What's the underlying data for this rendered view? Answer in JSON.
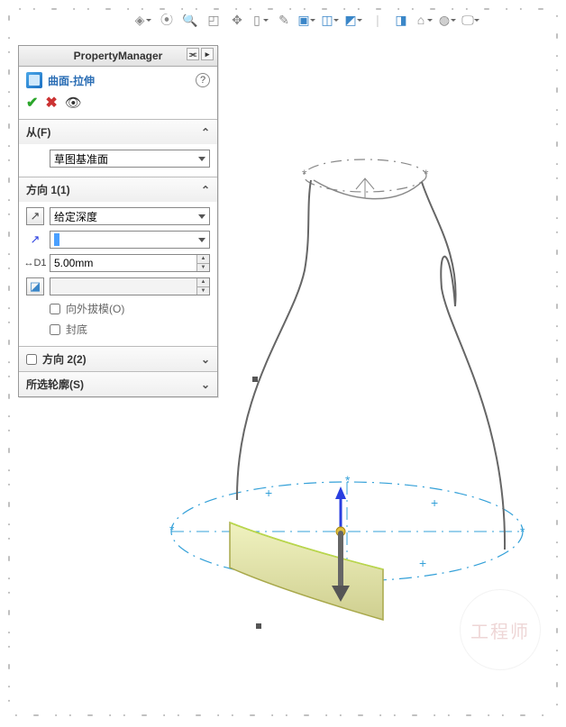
{
  "toolbar_icons": [
    "view-orientation",
    "zoom-prev",
    "zoom",
    "zoom-window",
    "pan",
    "section",
    "display-style",
    "hide-show",
    "render-style",
    "view-settings",
    "perspective",
    "camera",
    "shadow",
    "monitor"
  ],
  "pm": {
    "title": "PropertyManager",
    "feature_title": "曲面-拉伸",
    "help": "?",
    "from": {
      "header": "从(F)",
      "value": "草图基准面"
    },
    "dir1": {
      "header": "方向 1(1)",
      "end": "给定深度",
      "depth_value": "",
      "dim_value": "5.00mm",
      "draft_out": "向外拔模(O)",
      "cap_bottom": "封底"
    },
    "dir2": {
      "header": "方向 2(2)"
    },
    "contours": {
      "header": "所选轮廓(S)"
    }
  },
  "watermark": "工程师"
}
